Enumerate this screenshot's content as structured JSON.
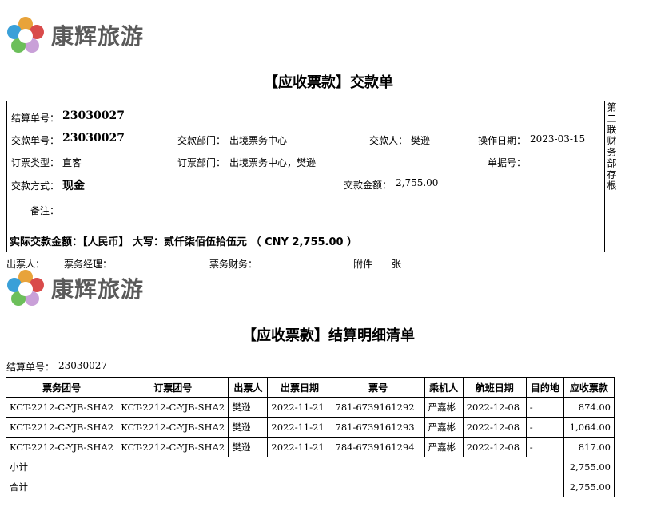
{
  "brand": {
    "name": "康辉旅游"
  },
  "receipt": {
    "title": "【应收票款】交款单",
    "settle_no_label": "结算单号：",
    "settle_no": "23030027",
    "pay_no_label": "交款单号：",
    "pay_no": "23030027",
    "pay_dept_label": "交款部门：",
    "pay_dept": "出境票务中心",
    "payer_label": "交款人：",
    "payer": "樊逊",
    "op_date_label": "操作日期：",
    "op_date": "2023-03-15",
    "ticket_type_label": "订票类型：",
    "ticket_type": "直客",
    "order_dept_label": "订票部门：",
    "order_dept": "出境票务中心，樊逊",
    "doc_no_label": "单据号：",
    "pay_method_label": "交款方式：",
    "pay_method": "现金",
    "amount_label": "交款金额：",
    "amount": "2,755.00",
    "remark_label": "备注：",
    "actual": "实际交款金额：【人民币】 大写：贰仟柒佰伍拾伍元 （ CNY 2,755.00 ）",
    "side_note": "第二联财务部存根"
  },
  "signatures": {
    "issuer": "出票人：",
    "manager": "票务经理：",
    "finance": "票务财务：",
    "attach": "附件",
    "sheets": "张"
  },
  "detail": {
    "title": "【应收票款】结算明细清单",
    "settle_no_label": "结算单号：",
    "settle_no": "23030027",
    "columns": [
      "票务团号",
      "订票团号",
      "出票人",
      "出票日期",
      "票号",
      "乘机人",
      "航班日期",
      "目的地",
      "应收票款"
    ],
    "rows": [
      [
        "KCT-2212-C-YJB-SHA2",
        "KCT-2212-C-YJB-SHA2",
        "樊逊",
        "2022-11-21",
        "781-6739161292",
        "严嘉彬",
        "2022-12-08",
        "-",
        "874.00"
      ],
      [
        "KCT-2212-C-YJB-SHA2",
        "KCT-2212-C-YJB-SHA2",
        "樊逊",
        "2022-11-21",
        "781-6739161293",
        "严嘉彬",
        "2022-12-08",
        "-",
        "1,064.00"
      ],
      [
        "KCT-2212-C-YJB-SHA2",
        "KCT-2212-C-YJB-SHA2",
        "樊逊",
        "2022-11-21",
        "784-6739161294",
        "严嘉彬",
        "2022-12-08",
        "-",
        "817.00"
      ]
    ],
    "subtotal_label": "小计",
    "subtotal": "2,755.00",
    "total_label": "合计",
    "total": "2,755.00"
  }
}
